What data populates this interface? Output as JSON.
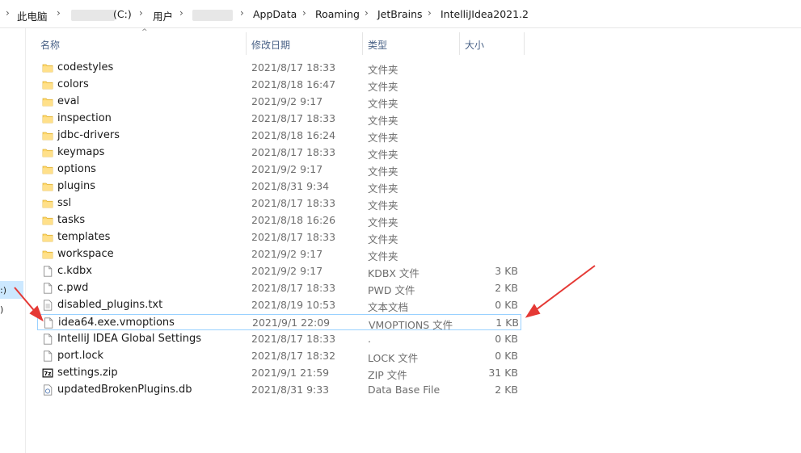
{
  "breadcrumb": {
    "items": [
      "此电脑",
      "(C:)",
      "用户",
      "AppData",
      "Roaming",
      "JetBrains",
      "IntelliJIdea2021.2"
    ],
    "separator": "›"
  },
  "nav_pane": {
    "selected_text": ":)",
    "next_text": ")"
  },
  "columns": {
    "name": "名称",
    "date": "修改日期",
    "type": "类型",
    "size": "大小",
    "sort_indicator": "^"
  },
  "files": [
    {
      "name": "codestyles",
      "date": "2021/8/17 18:33",
      "type": "文件夹",
      "size": "",
      "icon": "folder-icon"
    },
    {
      "name": "colors",
      "date": "2021/8/18 16:47",
      "type": "文件夹",
      "size": "",
      "icon": "folder-icon"
    },
    {
      "name": "eval",
      "date": "2021/9/2 9:17",
      "type": "文件夹",
      "size": "",
      "icon": "folder-icon"
    },
    {
      "name": "inspection",
      "date": "2021/8/17 18:33",
      "type": "文件夹",
      "size": "",
      "icon": "folder-icon"
    },
    {
      "name": "jdbc-drivers",
      "date": "2021/8/18 16:24",
      "type": "文件夹",
      "size": "",
      "icon": "folder-icon"
    },
    {
      "name": "keymaps",
      "date": "2021/8/17 18:33",
      "type": "文件夹",
      "size": "",
      "icon": "folder-icon"
    },
    {
      "name": "options",
      "date": "2021/9/2 9:17",
      "type": "文件夹",
      "size": "",
      "icon": "folder-icon"
    },
    {
      "name": "plugins",
      "date": "2021/8/31 9:34",
      "type": "文件夹",
      "size": "",
      "icon": "folder-icon"
    },
    {
      "name": "ssl",
      "date": "2021/8/17 18:33",
      "type": "文件夹",
      "size": "",
      "icon": "folder-icon"
    },
    {
      "name": "tasks",
      "date": "2021/8/18 16:26",
      "type": "文件夹",
      "size": "",
      "icon": "folder-icon"
    },
    {
      "name": "templates",
      "date": "2021/8/17 18:33",
      "type": "文件夹",
      "size": "",
      "icon": "folder-icon"
    },
    {
      "name": "workspace",
      "date": "2021/9/2 9:17",
      "type": "文件夹",
      "size": "",
      "icon": "folder-icon"
    },
    {
      "name": "c.kdbx",
      "date": "2021/9/2 9:17",
      "type": "KDBX 文件",
      "size": "3 KB",
      "icon": "file-icon"
    },
    {
      "name": "c.pwd",
      "date": "2021/8/17 18:33",
      "type": "PWD 文件",
      "size": "2 KB",
      "icon": "file-icon"
    },
    {
      "name": "disabled_plugins.txt",
      "date": "2021/8/19 10:53",
      "type": "文本文档",
      "size": "0 KB",
      "icon": "text-file-icon"
    },
    {
      "name": "idea64.exe.vmoptions",
      "date": "2021/9/1 22:09",
      "type": "VMOPTIONS 文件",
      "size": "1 KB",
      "icon": "file-icon",
      "selected": true
    },
    {
      "name": "IntelliJ IDEA Global Settings",
      "date": "2021/8/17 18:33",
      "type": ".",
      "size": "0 KB",
      "icon": "file-icon"
    },
    {
      "name": "port.lock",
      "date": "2021/8/17 18:32",
      "type": "LOCK 文件",
      "size": "0 KB",
      "icon": "file-icon"
    },
    {
      "name": "settings.zip",
      "date": "2021/9/1 21:59",
      "type": "ZIP 文件",
      "size": "31 KB",
      "icon": "zip-icon"
    },
    {
      "name": "updatedBrokenPlugins.db",
      "date": "2021/8/31 9:33",
      "type": "Data Base File",
      "size": "2 KB",
      "icon": "db-file-icon"
    }
  ],
  "colors": {
    "folder": "#ffd768",
    "selection_border": "#99d1ff",
    "annotation_arrow": "#e53935",
    "header_text": "#4a6287"
  }
}
